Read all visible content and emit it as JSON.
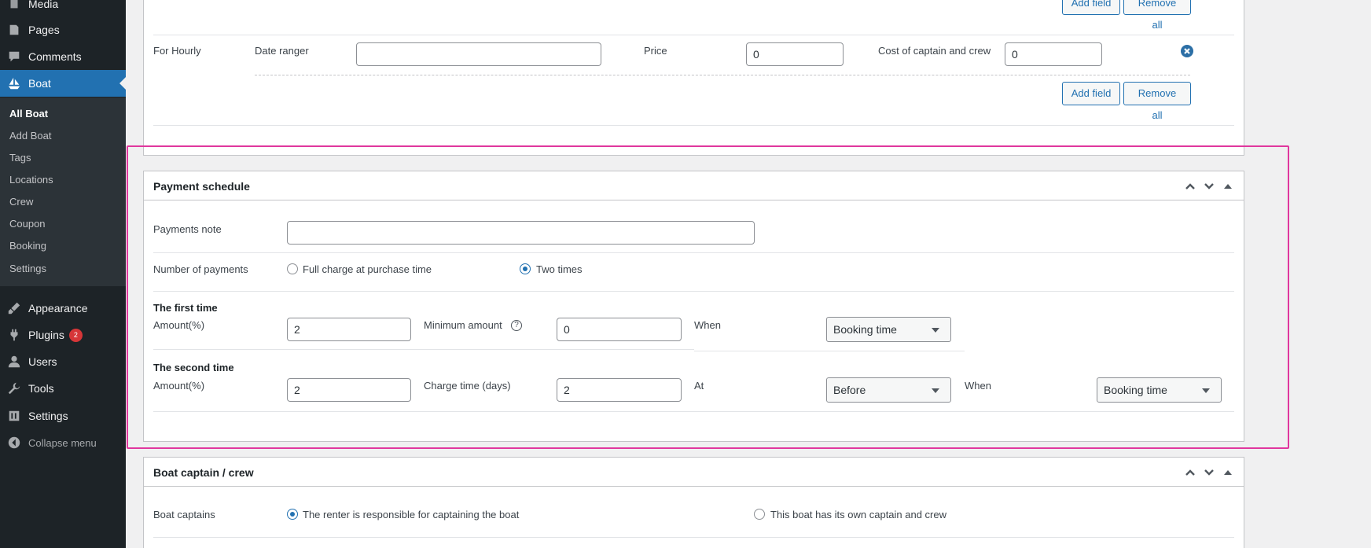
{
  "sidebar": {
    "menu": [
      {
        "label": "Media",
        "icon": "media-icon"
      },
      {
        "label": "Pages",
        "icon": "pages-icon"
      },
      {
        "label": "Comments",
        "icon": "comments-icon"
      },
      {
        "label": "Boat",
        "icon": "boat-icon",
        "current": true
      },
      {
        "label": "Appearance",
        "icon": "paintbrush-icon"
      },
      {
        "label": "Plugins",
        "icon": "plugin-icon",
        "badge": "2"
      },
      {
        "label": "Users",
        "icon": "users-icon"
      },
      {
        "label": "Tools",
        "icon": "wrench-icon"
      },
      {
        "label": "Settings",
        "icon": "settings-icon"
      }
    ],
    "submenu": [
      "All Boat",
      "Add Boat",
      "Tags",
      "Locations",
      "Crew",
      "Coupon",
      "Booking",
      "Settings"
    ],
    "collapse_label": "Collapse menu"
  },
  "pricing": {
    "add_field_label": "Add field",
    "remove_all_label": "Remove all",
    "hourly": {
      "label": "For Hourly",
      "date_range_label": "Date ranger",
      "date_range_value": "",
      "price_label": "Price",
      "price_value": "0",
      "crew_cost_label": "Cost of captain and crew",
      "crew_cost_value": "0"
    }
  },
  "payment_schedule": {
    "title": "Payment schedule",
    "payments_note_label": "Payments note",
    "payments_note_value": "",
    "number_of_payments_label": "Number of payments",
    "option_full": "Full charge at purchase time",
    "option_two": "Two times",
    "selected_option": "Two times",
    "first": {
      "heading": "The first time",
      "amount_label": "Amount(%)",
      "amount_value": "2",
      "minimum_label": "Minimum amount",
      "minimum_value": "0",
      "when_label": "When",
      "when_value": "Booking time"
    },
    "second": {
      "heading": "The second time",
      "amount_label": "Amount(%)",
      "amount_value": "2",
      "charge_time_label": "Charge time (days)",
      "charge_time_value": "2",
      "at_label": "At",
      "at_value": "Before",
      "when_label": "When",
      "when_value": "Booking time"
    }
  },
  "captain_crew": {
    "title": "Boat captain / crew",
    "boat_captains_label": "Boat captains",
    "option_renter": "The renter is responsible for captaining the boat",
    "option_own": "This boat has its own captain and crew",
    "selected_option": "The renter is responsible for captaining the boat"
  },
  "colors": {
    "accent": "#2271b1",
    "sidebar_bg": "#1d2327",
    "highlight": "#e0379e",
    "badge": "#d63638"
  }
}
